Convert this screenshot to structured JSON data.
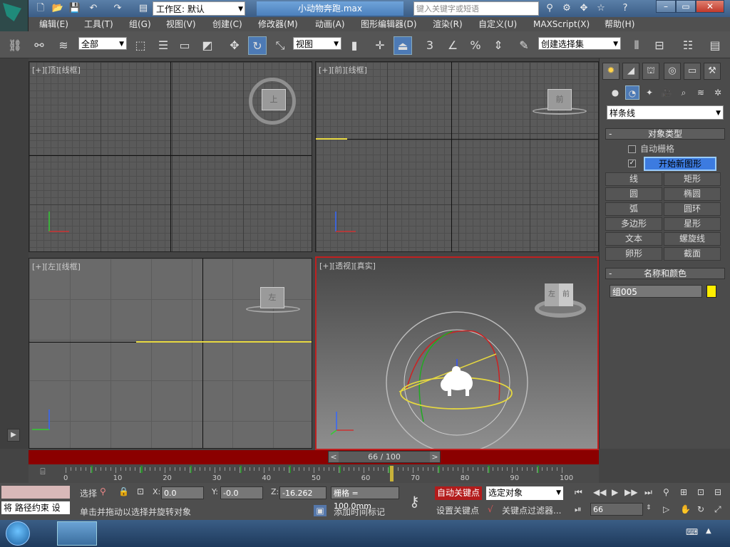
{
  "titlebar": {
    "workspace": "工作区: 默认",
    "document_title": "小动物奔跑.max",
    "search_placeholder": "键入关键字或短语"
  },
  "menu": [
    "编辑(E)",
    "工具(T)",
    "组(G)",
    "视图(V)",
    "创建(C)",
    "修改器(M)",
    "动画(A)",
    "图形编辑器(D)",
    "渲染(R)",
    "自定义(U)",
    "MAXScript(X)",
    "帮助(H)"
  ],
  "toolbar": {
    "selection_filter": "全部",
    "reference_coord": "视图",
    "named_selection": "创建选择集",
    "snap_label": "3",
    "percent_label": "%"
  },
  "viewports": {
    "top": {
      "label": "[+][顶][线框]",
      "cube": "上"
    },
    "front": {
      "label": "[+][前][线框]",
      "cube": "前"
    },
    "left": {
      "label": "[+][左][线框]",
      "cube": "左"
    },
    "perspective": {
      "label": "[+][透视][真实]",
      "cube_left": "左",
      "cube_front": "前"
    }
  },
  "command_panel": {
    "category": "样条线",
    "object_type_title": "对象类型",
    "auto_grid": "自动栅格",
    "start_new_shape": "开始新图形",
    "shapes": [
      "线",
      "矩形",
      "圆",
      "椭圆",
      "弧",
      "圆环",
      "多边形",
      "星形",
      "文本",
      "螺旋线",
      "卵形",
      "截面"
    ],
    "name_color_title": "名称和颜色",
    "object_name": "组005",
    "object_color": "#ffee00"
  },
  "timeline": {
    "slider_text": "66 / 100",
    "ticks": [
      "0",
      "10",
      "20",
      "30",
      "40",
      "50",
      "60",
      "70",
      "80",
      "90",
      "100"
    ]
  },
  "status": {
    "selected_label": "选择",
    "prompt_line": "将 路径约束 设",
    "x_value": "0.0",
    "y_value": "-0.0",
    "z_value": "-16.262",
    "grid_text": "栅格 = 100.0mm",
    "hint": "单击并拖动以选择并旋转对象",
    "add_time_tag": "添加时间标记",
    "auto_key": "自动关键点",
    "set_key": "设置关键点",
    "key_filter_select": "选定对象",
    "key_filters": "关键点过滤器...",
    "current_frame": "66",
    "x_label": "X:",
    "y_label": "Y:",
    "z_label": "Z:"
  },
  "colors": {
    "active_viewport_border": "#c02020",
    "selection_highlight": "#4d7ab5",
    "auto_key_red": "#b31c1c",
    "path_yellow": "#e6d840"
  }
}
